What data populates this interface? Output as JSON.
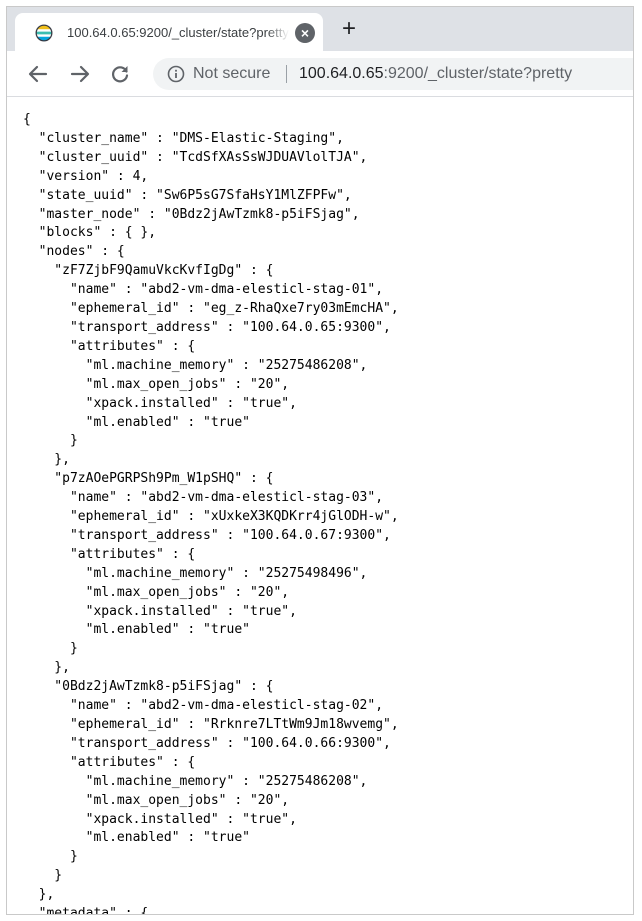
{
  "browser": {
    "tab": {
      "title": "100.64.0.65:9200/_cluster/state?pretty",
      "close_label": "×"
    },
    "new_tab_label": "+",
    "toolbar": {
      "security_label": "Not secure",
      "url_host": "100.64.0.65",
      "url_rest": ":9200/_cluster/state?pretty"
    },
    "icons": {
      "favicon": "elasticsearch-logo-icon",
      "back": "arrow-left-icon",
      "forward": "arrow-right-icon",
      "reload": "reload-icon",
      "info": "info-circle-icon"
    }
  },
  "content_lines": [
    "{",
    "  \"cluster_name\" : \"DMS-Elastic-Staging\",",
    "  \"cluster_uuid\" : \"TcdSfXAsSsWJDUAVlolTJA\",",
    "  \"version\" : 4,",
    "  \"state_uuid\" : \"Sw6P5sG7SfaHsY1MlZFPFw\",",
    "  \"master_node\" : \"0Bdz2jAwTzmk8-p5iFSjag\",",
    "  \"blocks\" : { },",
    "  \"nodes\" : {",
    "    \"zF7ZjbF9QamuVkcKvfIgDg\" : {",
    "      \"name\" : \"abd2-vm-dma-elesticl-stag-01\",",
    "      \"ephemeral_id\" : \"eg_z-RhaQxe7ry03mEmcHA\",",
    "      \"transport_address\" : \"100.64.0.65:9300\",",
    "      \"attributes\" : {",
    "        \"ml.machine_memory\" : \"25275486208\",",
    "        \"ml.max_open_jobs\" : \"20\",",
    "        \"xpack.installed\" : \"true\",",
    "        \"ml.enabled\" : \"true\"",
    "      }",
    "    },",
    "    \"p7zAOePGRPSh9Pm_W1pSHQ\" : {",
    "      \"name\" : \"abd2-vm-dma-elesticl-stag-03\",",
    "      \"ephemeral_id\" : \"xUxkeX3KQDKrr4jGlODH-w\",",
    "      \"transport_address\" : \"100.64.0.67:9300\",",
    "      \"attributes\" : {",
    "        \"ml.machine_memory\" : \"25275498496\",",
    "        \"ml.max_open_jobs\" : \"20\",",
    "        \"xpack.installed\" : \"true\",",
    "        \"ml.enabled\" : \"true\"",
    "      }",
    "    },",
    "    \"0Bdz2jAwTzmk8-p5iFSjag\" : {",
    "      \"name\" : \"abd2-vm-dma-elesticl-stag-02\",",
    "      \"ephemeral_id\" : \"Rrknre7LTtWm9Jm18wvemg\",",
    "      \"transport_address\" : \"100.64.0.66:9300\",",
    "      \"attributes\" : {",
    "        \"ml.machine_memory\" : \"25275486208\",",
    "        \"ml.max_open_jobs\" : \"20\",",
    "        \"xpack.installed\" : \"true\",",
    "        \"ml.enabled\" : \"true\"",
    "      }",
    "    }",
    "  },",
    "  \"metadata\" : {"
  ]
}
